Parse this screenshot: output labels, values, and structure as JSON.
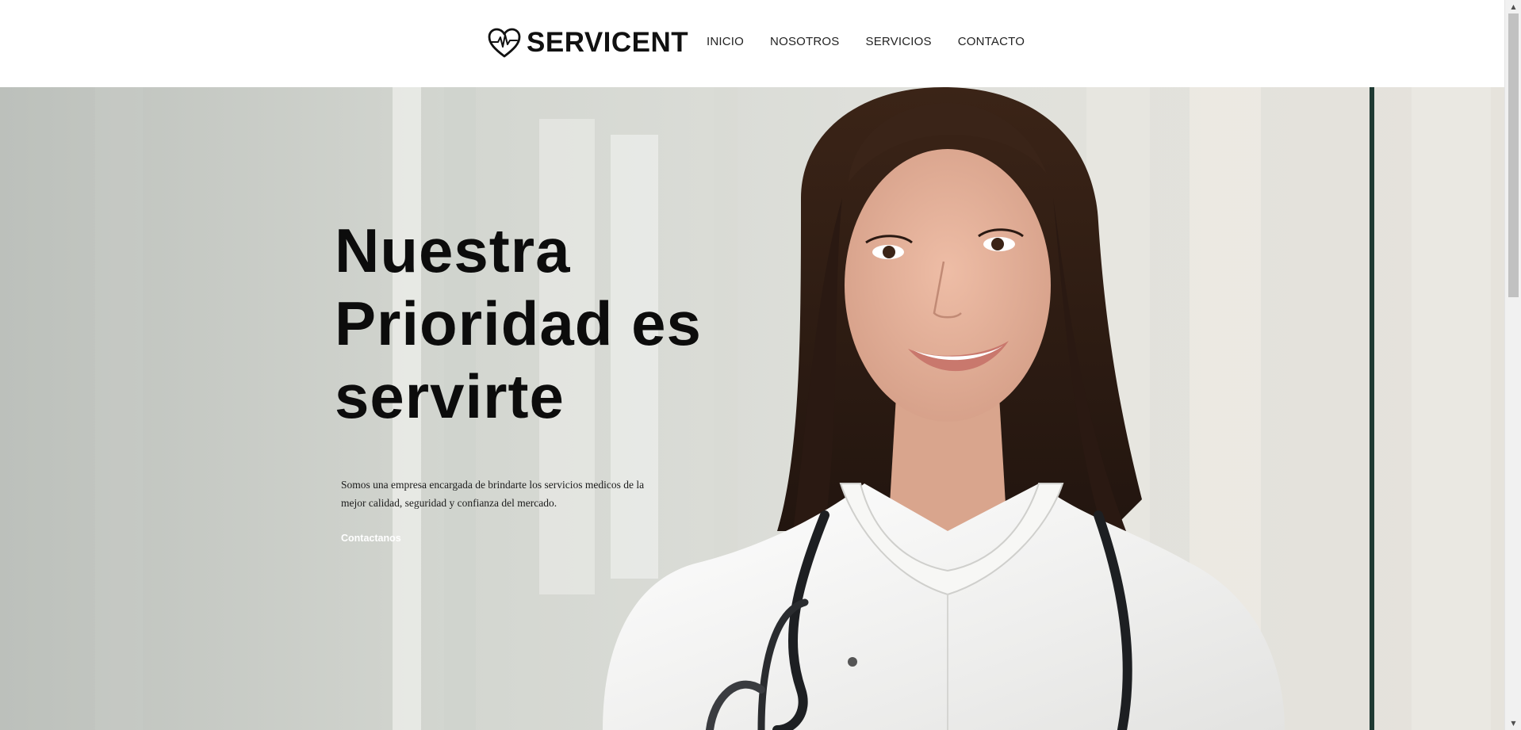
{
  "header": {
    "brand_name": "SERVICENT",
    "logo_icon": "heart-pulse-icon",
    "nav": [
      {
        "label": "INICIO"
      },
      {
        "label": "NOSOTROS"
      },
      {
        "label": "SERVICIOS"
      },
      {
        "label": "CONTACTO"
      }
    ]
  },
  "hero": {
    "title": "Nuestra Prioridad es servirte",
    "description": "Somos una empresa encargada de brindarte los servicios medicos de la mejor calidad, seguridad y confianza del mercado.",
    "cta_label": "Contactanos",
    "photo_subject": "smiling doctor in white coat with stethoscope"
  },
  "colors": {
    "text_dark": "#0c0c0c",
    "header_bg": "#ffffff",
    "coat_white": "#f4f4f2",
    "hair_brown": "#3a2418",
    "skin": "#e2b29c"
  }
}
